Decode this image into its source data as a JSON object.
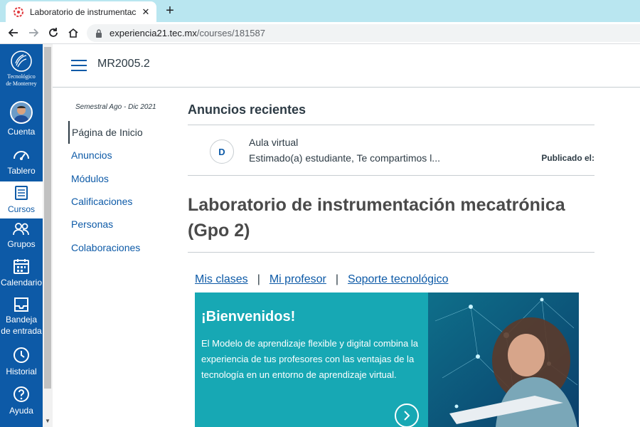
{
  "browser": {
    "tab_title": "Laboratorio de instrumentación",
    "tab_close": "✕",
    "new_tab": "+",
    "url_host": "experiencia21.tec.mx",
    "url_path": "/courses/181587"
  },
  "global_nav": {
    "logo_line1": "Tecnológico",
    "logo_line2": "de Monterrey",
    "items": [
      {
        "label": "Cuenta",
        "icon": "avatar"
      },
      {
        "label": "Tablero",
        "icon": "dashboard-icon"
      },
      {
        "label": "Cursos",
        "icon": "courses-icon",
        "active": true
      },
      {
        "label": "Grupos",
        "icon": "groups-icon"
      },
      {
        "label": "Calendario",
        "icon": "calendar-icon"
      },
      {
        "label": "Bandeja de entrada",
        "icon": "inbox-icon"
      },
      {
        "label": "Historial",
        "icon": "history-icon"
      },
      {
        "label": "Ayuda",
        "icon": "help-icon"
      }
    ]
  },
  "header": {
    "breadcrumb": "MR2005.2"
  },
  "course_nav": {
    "term": "Semestral Ago - Dic 2021",
    "items": [
      {
        "label": "Página de Inicio",
        "active": true
      },
      {
        "label": "Anuncios"
      },
      {
        "label": "Módulos"
      },
      {
        "label": "Calificaciones"
      },
      {
        "label": "Personas"
      },
      {
        "label": "Colaboraciones"
      }
    ]
  },
  "announcements": {
    "heading": "Anuncios recientes",
    "items": [
      {
        "avatar_letter": "D",
        "title": "Aula virtual",
        "snippet": "Estimado(a) estudiante, Te compartimos l...",
        "posted_label": "Publicado el:"
      }
    ]
  },
  "course": {
    "title": "Laboratorio de instrumentación mecatrónica (Gpo 2)"
  },
  "quick_links": [
    {
      "label": "Mis clases"
    },
    {
      "label": "Mi profesor"
    },
    {
      "label": "Soporte tecnológico"
    }
  ],
  "quick_links_separator": "|",
  "banner": {
    "title": "¡Bienvenidos!",
    "text": "El Modelo de aprendizaje flexible y digital combina la experiencia de tus profesores con las ventajas de la tecnología en un entorno de aprendizaje virtual."
  },
  "colors": {
    "brand": "#0d5aa7",
    "banner": "#17a8b4",
    "text": "#2d3b45",
    "chrome_tabstrip": "#b9e6f0"
  }
}
